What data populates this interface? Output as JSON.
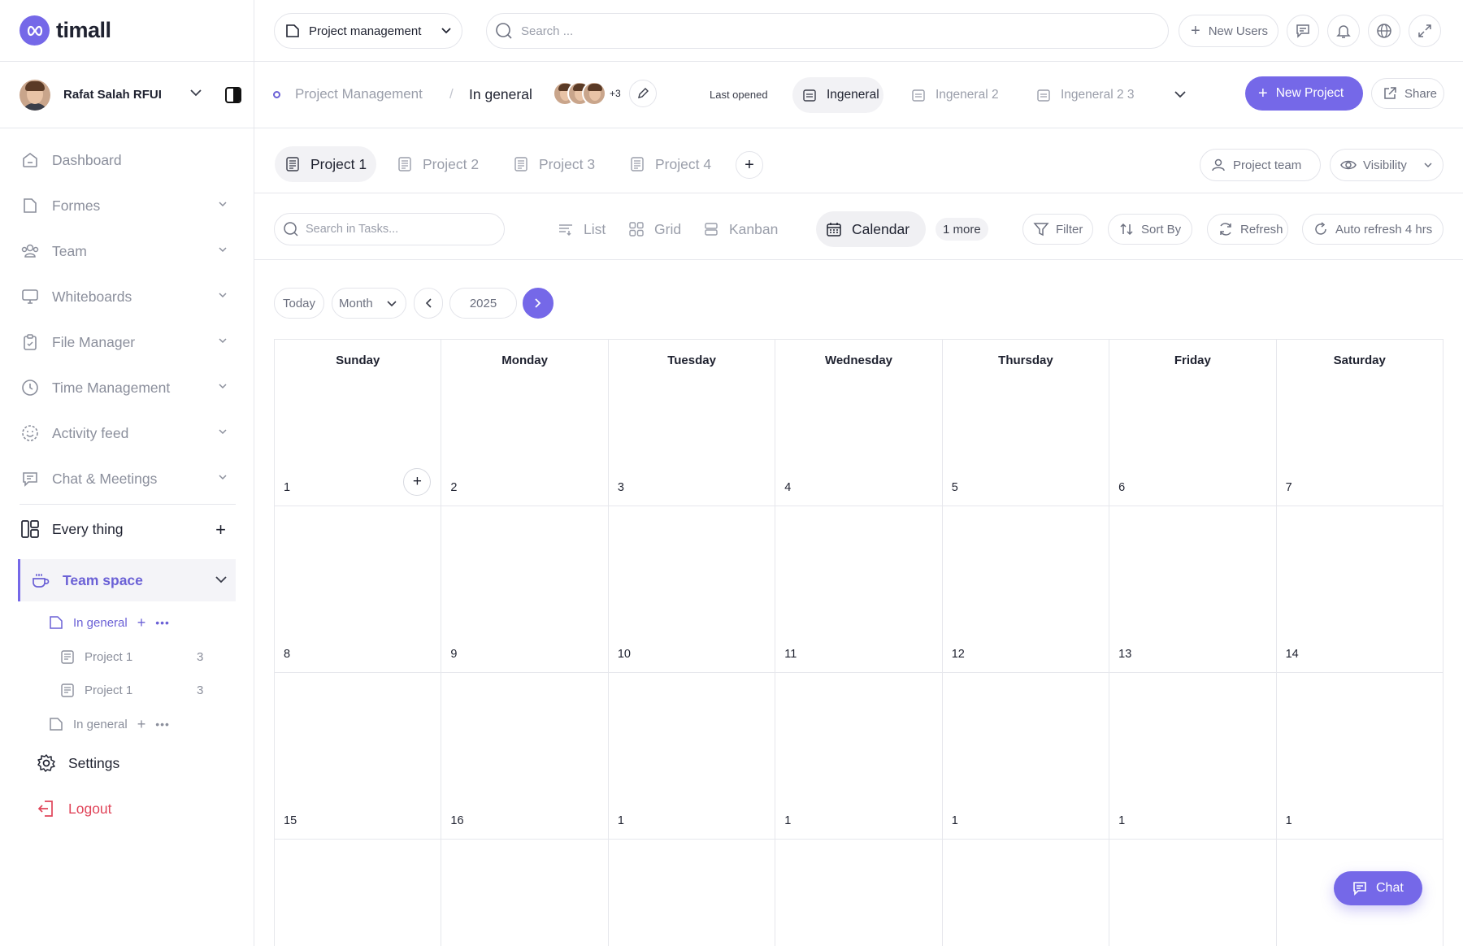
{
  "app": {
    "name": "timall"
  },
  "user": {
    "name": "Rafat Salah RFUI"
  },
  "sidebar": {
    "items": [
      {
        "label": "Dashboard",
        "icon": "home-icon"
      },
      {
        "label": "Formes",
        "icon": "folder-icon"
      },
      {
        "label": "Team",
        "icon": "team-icon"
      },
      {
        "label": "Whiteboards",
        "icon": "monitor-icon"
      },
      {
        "label": "File Manager",
        "icon": "clipboard-icon"
      },
      {
        "label": "Time Management",
        "icon": "clock-icon"
      },
      {
        "label": "Activity feed",
        "icon": "smiley-icon"
      },
      {
        "label": "Chat & Meetings",
        "icon": "chat-icon"
      }
    ],
    "every_thing": "Every thing",
    "team_space": "Team space",
    "sub": [
      {
        "label": "In general",
        "count": ""
      },
      {
        "label": "Project 1",
        "count": "3"
      },
      {
        "label": "Project 1",
        "count": "3"
      },
      {
        "label": "In general",
        "count": ""
      }
    ],
    "settings": "Settings",
    "logout": "Logout"
  },
  "topbar": {
    "project_select": "Project management",
    "search_placeholder": "Search ...",
    "new_users": "New Users"
  },
  "breadcrumb": {
    "root": "Project Management",
    "separator": "/",
    "current": "In general",
    "members_extra": "+3",
    "last_opened_label": "Last opened",
    "tabs": [
      "Ingeneral",
      "Ingeneral 2",
      "Ingeneral 2 3"
    ],
    "new_project": "New Project",
    "share": "Share"
  },
  "project_tabs": {
    "tabs": [
      "Project 1",
      "Project 2",
      "Project 3",
      "Project 4"
    ],
    "add": "+",
    "project_team": "Project team",
    "visibility": "Visibility"
  },
  "toolbar": {
    "task_search_placeholder": "Search in Tasks...",
    "views": [
      "List",
      "Grid",
      "Kanban",
      "Calendar"
    ],
    "more": "1 more",
    "filter": "Filter",
    "sort_by": "Sort By",
    "refresh": "Refresh",
    "auto_refresh": "Auto refresh 4 hrs"
  },
  "calendar": {
    "today": "Today",
    "view_mode": "Month",
    "year": "2025",
    "weekdays": [
      "Sunday",
      "Monday",
      "Tuesday",
      "Wednesday",
      "Thursday",
      "Friday",
      "Saturday"
    ],
    "weeks": [
      [
        "1",
        "2",
        "3",
        "4",
        "5",
        "6",
        "7"
      ],
      [
        "8",
        "9",
        "10",
        "11",
        "12",
        "13",
        "14"
      ],
      [
        "15",
        "16",
        "1",
        "1",
        "1",
        "1",
        "1"
      ],
      [
        "",
        "",
        "",
        "",
        "",
        "",
        ""
      ]
    ],
    "add": "+"
  },
  "chat": {
    "label": "Chat"
  },
  "colors": {
    "accent": "#7568e8",
    "danger": "#e0455a",
    "text": "#1f2230",
    "muted": "#9a9eaa",
    "border": "#e6e7ec"
  }
}
